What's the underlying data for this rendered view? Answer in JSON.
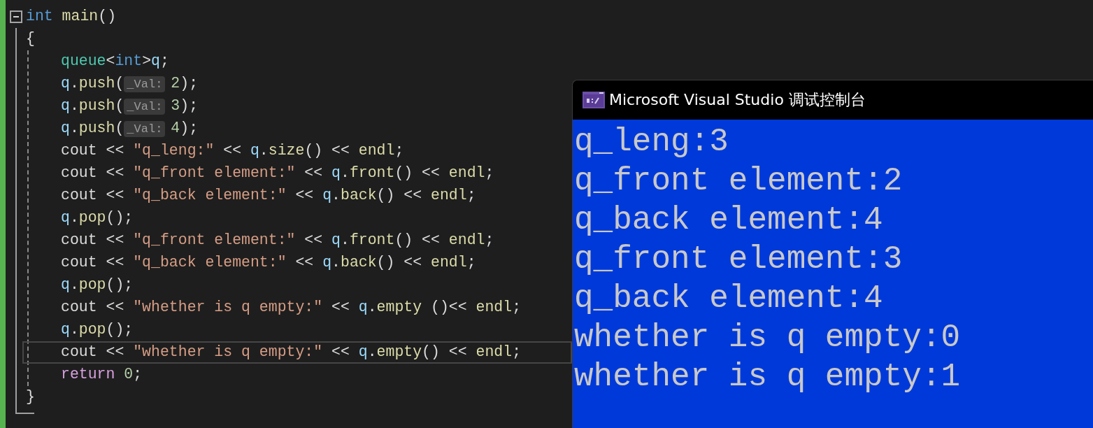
{
  "editor": {
    "lines": [
      {
        "expanded": true,
        "tokens": [
          {
            "kind": "keyword",
            "text": "int"
          },
          {
            "kind": "func",
            "text": " main"
          },
          {
            "kind": "plain",
            "text": "()"
          }
        ],
        "children": [
          {
            "tokens": [
              {
                "kind": "plain",
                "text": "{"
              }
            ],
            "children": [
              {
                "tokens": [
                  {
                    "kind": "type",
                    "text": "queue"
                  },
                  {
                    "kind": "plain",
                    "text": "<"
                  },
                  {
                    "kind": "keyword",
                    "text": "int"
                  },
                  {
                    "kind": "plain",
                    "text": ">"
                  },
                  {
                    "kind": "var",
                    "text": "q"
                  },
                  {
                    "kind": "plain",
                    "text": ";"
                  }
                ]
              },
              {
                "tokens": [
                  {
                    "kind": "var",
                    "text": "q"
                  },
                  {
                    "kind": "plain",
                    "text": "."
                  },
                  {
                    "kind": "func",
                    "text": "push"
                  },
                  {
                    "kind": "plain",
                    "text": "("
                  },
                  {
                    "kind": "hint",
                    "text": "_Val:"
                  },
                  {
                    "kind": "number",
                    "text": "2"
                  },
                  {
                    "kind": "plain",
                    "text": ");"
                  }
                ]
              },
              {
                "tokens": [
                  {
                    "kind": "var",
                    "text": "q"
                  },
                  {
                    "kind": "plain",
                    "text": "."
                  },
                  {
                    "kind": "func",
                    "text": "push"
                  },
                  {
                    "kind": "plain",
                    "text": "("
                  },
                  {
                    "kind": "hint",
                    "text": "_Val:"
                  },
                  {
                    "kind": "number",
                    "text": "3"
                  },
                  {
                    "kind": "plain",
                    "text": ");"
                  }
                ]
              },
              {
                "tokens": [
                  {
                    "kind": "var",
                    "text": "q"
                  },
                  {
                    "kind": "plain",
                    "text": "."
                  },
                  {
                    "kind": "func",
                    "text": "push"
                  },
                  {
                    "kind": "plain",
                    "text": "("
                  },
                  {
                    "kind": "hint",
                    "text": "_Val:"
                  },
                  {
                    "kind": "number",
                    "text": "4"
                  },
                  {
                    "kind": "plain",
                    "text": ");"
                  }
                ]
              },
              {
                "tokens": [
                  {
                    "kind": "plain",
                    "text": "cout << "
                  },
                  {
                    "kind": "string",
                    "text": "\"q_leng:\""
                  },
                  {
                    "kind": "plain",
                    "text": " << "
                  },
                  {
                    "kind": "var",
                    "text": "q"
                  },
                  {
                    "kind": "plain",
                    "text": "."
                  },
                  {
                    "kind": "func",
                    "text": "size"
                  },
                  {
                    "kind": "plain",
                    "text": "() << "
                  },
                  {
                    "kind": "func",
                    "text": "endl"
                  },
                  {
                    "kind": "plain",
                    "text": ";"
                  }
                ]
              },
              {
                "tokens": [
                  {
                    "kind": "plain",
                    "text": "cout << "
                  },
                  {
                    "kind": "string",
                    "text": "\"q_front element:\""
                  },
                  {
                    "kind": "plain",
                    "text": " << "
                  },
                  {
                    "kind": "var",
                    "text": "q"
                  },
                  {
                    "kind": "plain",
                    "text": "."
                  },
                  {
                    "kind": "func",
                    "text": "front"
                  },
                  {
                    "kind": "plain",
                    "text": "() << "
                  },
                  {
                    "kind": "func",
                    "text": "endl"
                  },
                  {
                    "kind": "plain",
                    "text": ";"
                  }
                ]
              },
              {
                "tokens": [
                  {
                    "kind": "plain",
                    "text": "cout << "
                  },
                  {
                    "kind": "string",
                    "text": "\"q_back element:\""
                  },
                  {
                    "kind": "plain",
                    "text": " << "
                  },
                  {
                    "kind": "var",
                    "text": "q"
                  },
                  {
                    "kind": "plain",
                    "text": "."
                  },
                  {
                    "kind": "func",
                    "text": "back"
                  },
                  {
                    "kind": "plain",
                    "text": "() << "
                  },
                  {
                    "kind": "func",
                    "text": "endl"
                  },
                  {
                    "kind": "plain",
                    "text": ";"
                  }
                ]
              },
              {
                "tokens": [
                  {
                    "kind": "var",
                    "text": "q"
                  },
                  {
                    "kind": "plain",
                    "text": "."
                  },
                  {
                    "kind": "func",
                    "text": "pop"
                  },
                  {
                    "kind": "plain",
                    "text": "();"
                  }
                ]
              },
              {
                "tokens": [
                  {
                    "kind": "plain",
                    "text": "cout << "
                  },
                  {
                    "kind": "string",
                    "text": "\"q_front element:\""
                  },
                  {
                    "kind": "plain",
                    "text": " << "
                  },
                  {
                    "kind": "var",
                    "text": "q"
                  },
                  {
                    "kind": "plain",
                    "text": "."
                  },
                  {
                    "kind": "func",
                    "text": "front"
                  },
                  {
                    "kind": "plain",
                    "text": "() << "
                  },
                  {
                    "kind": "func",
                    "text": "endl"
                  },
                  {
                    "kind": "plain",
                    "text": ";"
                  }
                ]
              },
              {
                "tokens": [
                  {
                    "kind": "plain",
                    "text": "cout << "
                  },
                  {
                    "kind": "string",
                    "text": "\"q_back element:\""
                  },
                  {
                    "kind": "plain",
                    "text": " << "
                  },
                  {
                    "kind": "var",
                    "text": "q"
                  },
                  {
                    "kind": "plain",
                    "text": "."
                  },
                  {
                    "kind": "func",
                    "text": "back"
                  },
                  {
                    "kind": "plain",
                    "text": "() << "
                  },
                  {
                    "kind": "func",
                    "text": "endl"
                  },
                  {
                    "kind": "plain",
                    "text": ";"
                  }
                ]
              },
              {
                "tokens": [
                  {
                    "kind": "var",
                    "text": "q"
                  },
                  {
                    "kind": "plain",
                    "text": "."
                  },
                  {
                    "kind": "func",
                    "text": "pop"
                  },
                  {
                    "kind": "plain",
                    "text": "();"
                  }
                ]
              },
              {
                "tokens": [
                  {
                    "kind": "plain",
                    "text": "cout << "
                  },
                  {
                    "kind": "string",
                    "text": "\"whether is q empty:\""
                  },
                  {
                    "kind": "plain",
                    "text": " << "
                  },
                  {
                    "kind": "var",
                    "text": "q"
                  },
                  {
                    "kind": "plain",
                    "text": "."
                  },
                  {
                    "kind": "func",
                    "text": "empty"
                  },
                  {
                    "kind": "plain",
                    "text": " ()<< "
                  },
                  {
                    "kind": "func",
                    "text": "endl"
                  },
                  {
                    "kind": "plain",
                    "text": ";"
                  }
                ]
              },
              {
                "tokens": [
                  {
                    "kind": "var",
                    "text": "q"
                  },
                  {
                    "kind": "plain",
                    "text": "."
                  },
                  {
                    "kind": "func",
                    "text": "pop"
                  },
                  {
                    "kind": "plain",
                    "text": "();"
                  }
                ]
              },
              {
                "current": true,
                "tokens": [
                  {
                    "kind": "plain",
                    "text": "cout << "
                  },
                  {
                    "kind": "string",
                    "text": "\"whether is q empty:\""
                  },
                  {
                    "kind": "plain",
                    "text": " << "
                  },
                  {
                    "kind": "var",
                    "text": "q"
                  },
                  {
                    "kind": "plain",
                    "text": "."
                  },
                  {
                    "kind": "func",
                    "text": "empty"
                  },
                  {
                    "kind": "plain",
                    "text": "() << "
                  },
                  {
                    "kind": "func",
                    "text": "endl"
                  },
                  {
                    "kind": "plain",
                    "text": ";"
                  }
                ]
              },
              {
                "tokens": [
                  {
                    "kind": "control",
                    "text": "return"
                  },
                  {
                    "kind": "number",
                    "text": " 0"
                  },
                  {
                    "kind": "plain",
                    "text": ";"
                  }
                ]
              }
            ]
          },
          {
            "tokens": [
              {
                "kind": "plain",
                "text": "}"
              }
            ]
          }
        ]
      }
    ]
  },
  "console": {
    "title": "Microsoft Visual Studio 调试控制台",
    "lines": [
      "q_leng:3",
      "q_front element:2",
      "q_back element:4",
      "q_front element:3",
      "q_back element:4",
      "whether is q empty:0",
      "whether is q empty:1"
    ]
  }
}
